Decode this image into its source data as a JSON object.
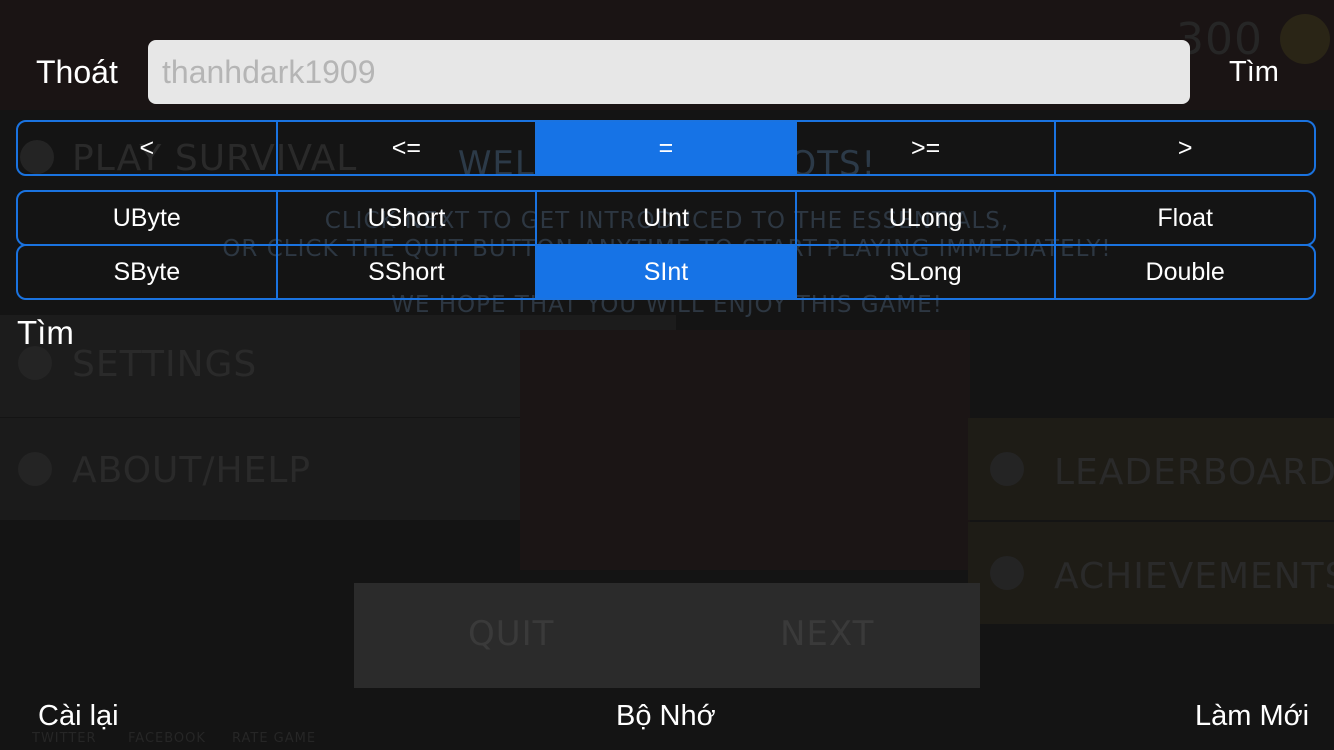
{
  "background": {
    "coins": "300",
    "menu": [
      "PLAY SURVIVAL",
      "SETTINGS",
      "ABOUT/HELP",
      "LEADERBOARDS",
      "ACHIEVEMENTS"
    ],
    "welcome_title": "WELCOME TO ROBOTS!",
    "welcome_lines": [
      "CLICK NEXT TO GET INTRODUCED TO THE ESSENTIALS,",
      "OR CLICK THE QUIT BUTTON ANYTIME TO START PLAYING IMMEDIATELY!",
      "WE HOPE THAT YOU WILL ENJOY THIS GAME!"
    ],
    "quit_label": "QUIT",
    "next_label": "NEXT",
    "social": [
      "TWITTER",
      "FACEBOOK",
      "RATE GAME"
    ]
  },
  "header": {
    "exit_label": "Thoát",
    "search_placeholder": "thanhdark1909",
    "search_value": "",
    "search_label": "Tìm"
  },
  "comparison": {
    "items": [
      "<",
      "<=",
      "=",
      ">=",
      ">"
    ],
    "selected": "="
  },
  "types": {
    "row1": [
      "UByte",
      "UShort",
      "UInt",
      "ULong",
      "Float"
    ],
    "row2": [
      "SByte",
      "SShort",
      "SInt",
      "SLong",
      "Double"
    ],
    "selected": "SInt"
  },
  "section_label": "Tìm",
  "footer": {
    "reset_label": "Cài lại",
    "memory_label": "Bộ Nhớ",
    "refresh_label": "Làm Mới"
  },
  "colors": {
    "accent": "#1673e6",
    "border": "#1a73e0",
    "input_bg": "#e7e7e7"
  }
}
